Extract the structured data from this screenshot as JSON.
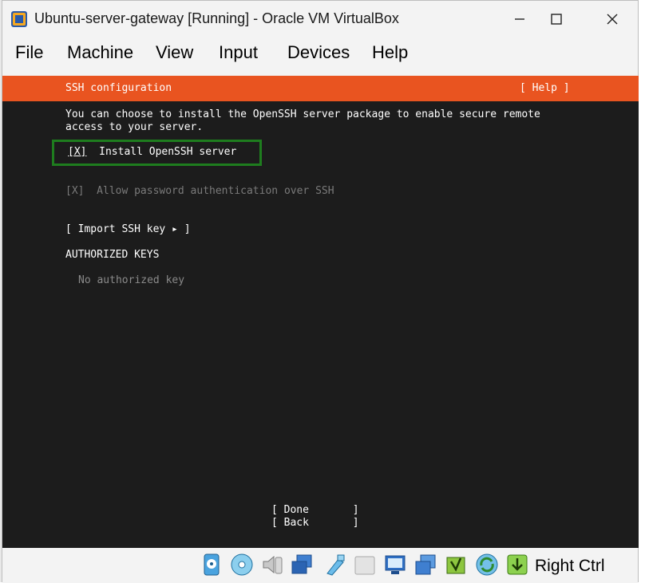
{
  "window": {
    "title": "Ubuntu-server-gateway [Running] - Oracle VM VirtualBox",
    "controls": [
      "minimize",
      "maximize",
      "close"
    ]
  },
  "menubar": {
    "items": [
      "File",
      "Machine",
      "View",
      "Input",
      "Devices",
      "Help"
    ]
  },
  "installer": {
    "header_title": "SSH configuration",
    "help_label": "[ Help ]",
    "description_line1": "You can choose to install the OpenSSH server package to enable secure remote",
    "description_line2": "access to your server.",
    "install_openssh": {
      "checkbox": "[X]",
      "label": "Install OpenSSH server",
      "checked": true
    },
    "allow_password": {
      "checkbox": "[X]",
      "label": "Allow password authentication over SSH",
      "checked": true,
      "disabled": true
    },
    "import_ssh_key": "[ Import SSH key ▸ ]",
    "authorized_keys_heading": "AUTHORIZED KEYS",
    "no_authorized_key": "No authorized key",
    "done_button": "[ Done       ]",
    "back_button": "[ Back       ]"
  },
  "statusbar": {
    "icons": [
      "hard-disk-icon",
      "optical-drive-icon",
      "audio-icon",
      "network-icon",
      "usb-icon",
      "shared-folders-icon",
      "display-icon",
      "screen-capture-icon",
      "recording-icon",
      "guest-additions-icon",
      "mouse-integration-icon"
    ],
    "host_key": "Right Ctrl"
  },
  "colors": {
    "accent": "#e95420",
    "terminal_bg": "#1c1c1c",
    "focus_border": "#1e7d1e"
  }
}
